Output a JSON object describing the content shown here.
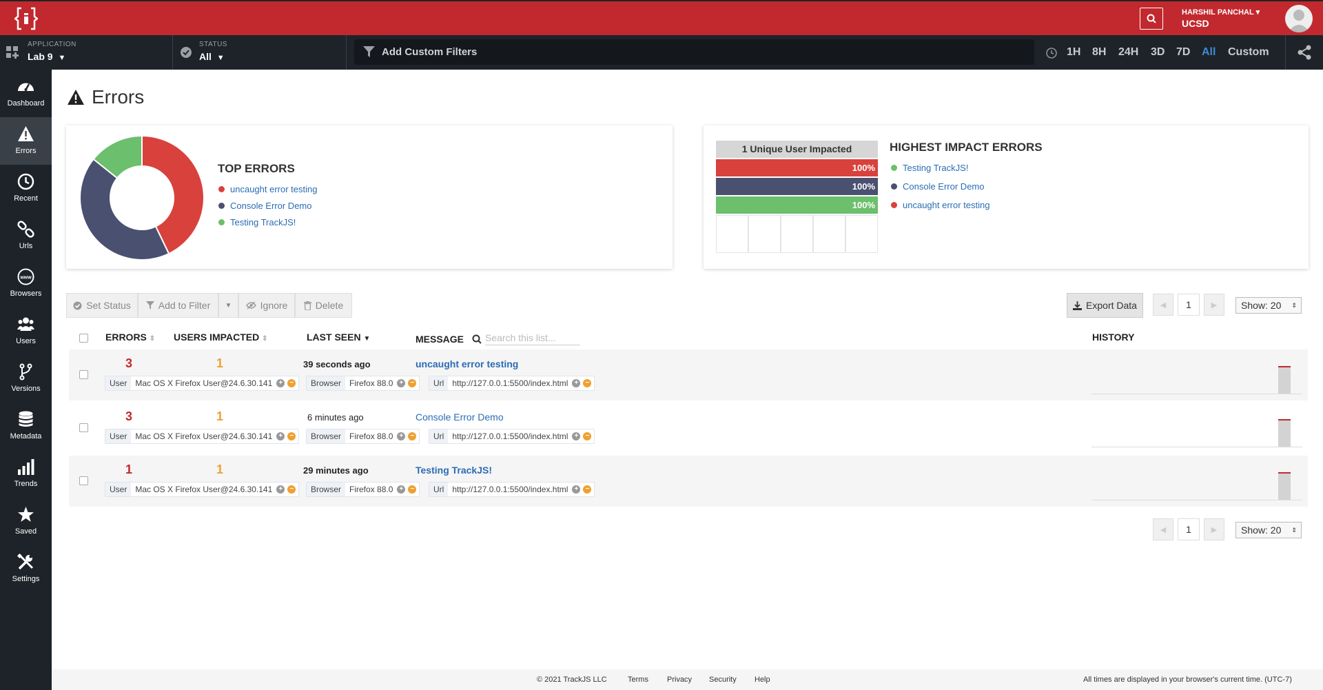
{
  "header": {
    "user_name": "HARSHIL PANCHAL",
    "user_org": "UCSD"
  },
  "subbar": {
    "application_label": "APPLICATION",
    "application_value": "Lab 9",
    "status_label": "STATUS",
    "status_value": "All",
    "filter_placeholder": "Add Custom Filters",
    "time_ranges": [
      "1H",
      "8H",
      "24H",
      "3D",
      "7D",
      "All",
      "Custom"
    ],
    "active_time_range": "All"
  },
  "sidebar": {
    "items": [
      {
        "label": "Dashboard",
        "icon": "dashboard-icon"
      },
      {
        "label": "Errors",
        "icon": "warning-icon"
      },
      {
        "label": "Recent",
        "icon": "clock-icon"
      },
      {
        "label": "Urls",
        "icon": "link-icon"
      },
      {
        "label": "Browsers",
        "icon": "globe-icon"
      },
      {
        "label": "Users",
        "icon": "users-icon"
      },
      {
        "label": "Versions",
        "icon": "branch-icon"
      },
      {
        "label": "Metadata",
        "icon": "database-icon"
      },
      {
        "label": "Trends",
        "icon": "bar-chart-icon"
      },
      {
        "label": "Saved",
        "icon": "star-icon"
      },
      {
        "label": "Settings",
        "icon": "tools-icon"
      }
    ],
    "active": "Errors"
  },
  "page": {
    "title": "Errors"
  },
  "top_errors": {
    "title": "TOP ERRORS",
    "items": [
      {
        "label": "uncaught error testing",
        "color": "#d9413d"
      },
      {
        "label": "Console Error Demo",
        "color": "#4a5070"
      },
      {
        "label": "Testing TrackJS!",
        "color": "#6cbf6c"
      }
    ]
  },
  "chart_data": {
    "type": "pie",
    "categories": [
      "uncaught error testing",
      "Console Error Demo",
      "Testing TrackJS!"
    ],
    "values": [
      3,
      3,
      1
    ],
    "colors": [
      "#d9413d",
      "#4a5070",
      "#6cbf6c"
    ]
  },
  "highest_impact": {
    "title": "HIGHEST IMPACT ERRORS",
    "header": "1 Unique User Impacted",
    "bars": [
      {
        "label": "100%",
        "color": "#d9413d",
        "value": 1.0
      },
      {
        "label": "100%",
        "color": "#4a5070",
        "value": 1.0
      },
      {
        "label": "100%",
        "color": "#6cbf6c",
        "value": 1.0
      }
    ],
    "items": [
      {
        "label": "Testing TrackJS!",
        "color": "#6cbf6c"
      },
      {
        "label": "Console Error Demo",
        "color": "#4a5070"
      },
      {
        "label": "uncaught error testing",
        "color": "#d9413d"
      }
    ]
  },
  "toolbar": {
    "set_status": "Set Status",
    "add_to_filter": "Add to Filter",
    "ignore": "Ignore",
    "delete": "Delete",
    "export": "Export Data",
    "page": "1",
    "show": "Show: 20"
  },
  "table": {
    "headers": {
      "errors": "ERRORS",
      "users": "USERS IMPACTED",
      "last_seen": "LAST SEEN",
      "message": "MESSAGE",
      "history": "HISTORY"
    },
    "search_placeholder": "Search this list...",
    "rows": [
      {
        "errors": "3",
        "users": "1",
        "last_seen": "39 seconds ago",
        "message": "uncaught error testing",
        "bold": true,
        "user_key": "User",
        "user_val": "Mac OS X Firefox User@24.6.30.141",
        "browser_key": "Browser",
        "browser_val": "Firefox 88.0",
        "url_key": "Url",
        "url_val": "http://127.0.0.1:5500/index.html"
      },
      {
        "errors": "3",
        "users": "1",
        "last_seen": "6 minutes ago",
        "message": "Console Error Demo",
        "bold": false,
        "user_key": "User",
        "user_val": "Mac OS X Firefox User@24.6.30.141",
        "browser_key": "Browser",
        "browser_val": "Firefox 88.0",
        "url_key": "Url",
        "url_val": "http://127.0.0.1:5500/index.html"
      },
      {
        "errors": "1",
        "users": "1",
        "last_seen": "29 minutes ago",
        "message": "Testing TrackJS!",
        "bold": true,
        "user_key": "User",
        "user_val": "Mac OS X Firefox User@24.6.30.141",
        "browser_key": "Browser",
        "browser_val": "Firefox 88.0",
        "url_key": "Url",
        "url_val": "http://127.0.0.1:5500/index.html"
      }
    ]
  },
  "footer": {
    "copyright": "© 2021 TrackJS LLC",
    "terms": "Terms",
    "privacy": "Privacy",
    "security": "Security",
    "help": "Help",
    "tz_note": "All times are displayed in your browser's current time. (UTC-7)"
  }
}
